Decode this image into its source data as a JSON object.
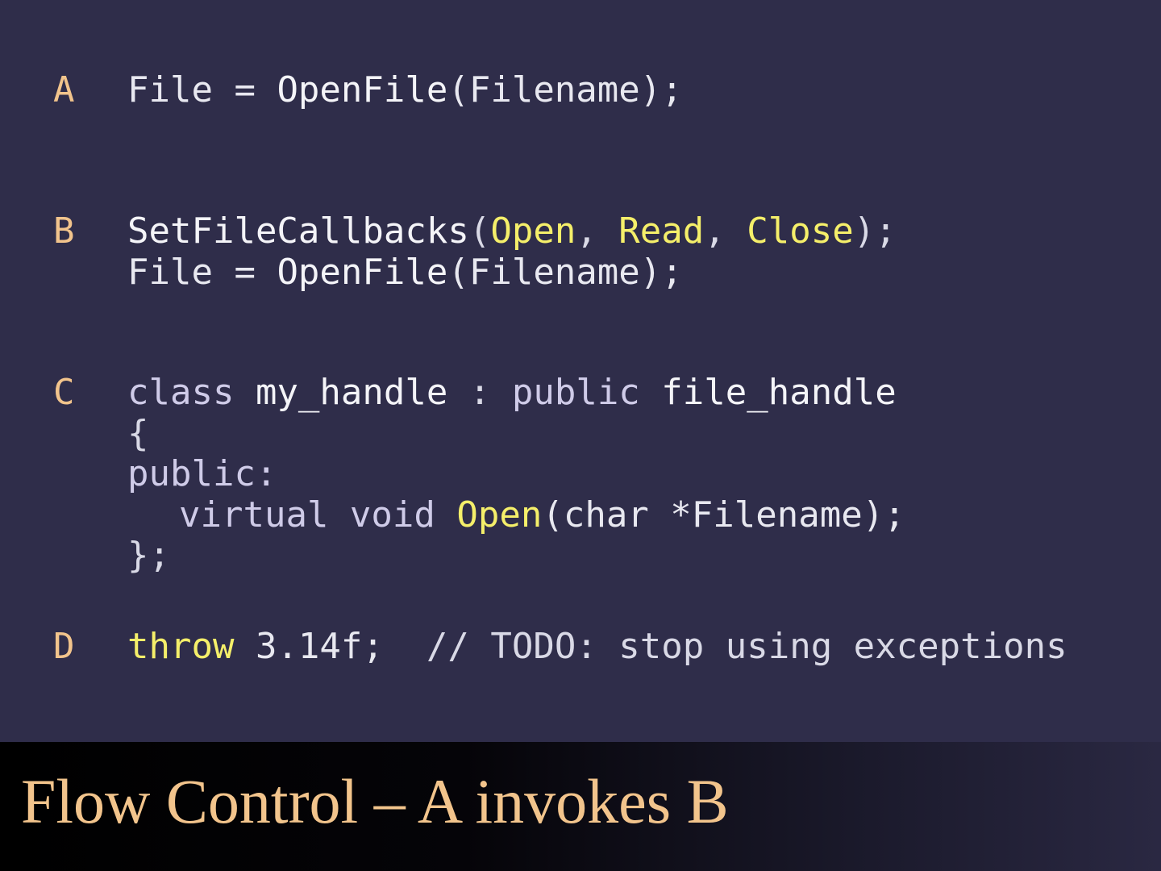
{
  "blocks": [
    {
      "label": "A",
      "lines": [
        [
          {
            "t": "File = ",
            "c": "plain"
          },
          {
            "t": "OpenFile",
            "c": "ident"
          },
          {
            "t": "(Filename);",
            "c": "plain"
          }
        ]
      ]
    },
    {
      "label": "B",
      "lines": [
        [
          {
            "t": "SetFileCallbacks",
            "c": "ident"
          },
          {
            "t": "(",
            "c": "punct"
          },
          {
            "t": "Open",
            "c": "hi"
          },
          {
            "t": ", ",
            "c": "punct"
          },
          {
            "t": "Read",
            "c": "hi"
          },
          {
            "t": ", ",
            "c": "punct"
          },
          {
            "t": "Close",
            "c": "hi"
          },
          {
            "t": ");",
            "c": "punct"
          }
        ],
        [
          {
            "t": "File = ",
            "c": "plain"
          },
          {
            "t": "OpenFile",
            "c": "ident"
          },
          {
            "t": "(Filename);",
            "c": "plain"
          }
        ]
      ]
    },
    {
      "label": "C",
      "lines": [
        [
          {
            "t": "class ",
            "c": "kw"
          },
          {
            "t": "my_handle",
            "c": "ident"
          },
          {
            "t": " : ",
            "c": "punct"
          },
          {
            "t": "public ",
            "c": "kw"
          },
          {
            "t": "file_handle",
            "c": "ident"
          }
        ],
        [
          {
            "t": "{",
            "c": "punct"
          }
        ],
        [
          {
            "t": "public:",
            "c": "kw"
          }
        ],
        [
          {
            "t": "virtual void ",
            "c": "kw",
            "indent": true
          },
          {
            "t": "Open",
            "c": "hi"
          },
          {
            "t": "(char *Filename);",
            "c": "plain"
          }
        ],
        [
          {
            "t": "};",
            "c": "punct"
          }
        ]
      ]
    },
    {
      "label": "D",
      "lines": [
        [
          {
            "t": "throw",
            "c": "hi"
          },
          {
            "t": " 3.14f;  ",
            "c": "plain"
          },
          {
            "t": "// TODO: stop using exceptions",
            "c": "comment"
          }
        ]
      ]
    }
  ],
  "title": "Flow Control – A invokes B",
  "colors": {
    "background": "#2f2d4a",
    "label": "#f2c48c",
    "highlight": "#f5ef6a",
    "title": "#f2c48c"
  }
}
